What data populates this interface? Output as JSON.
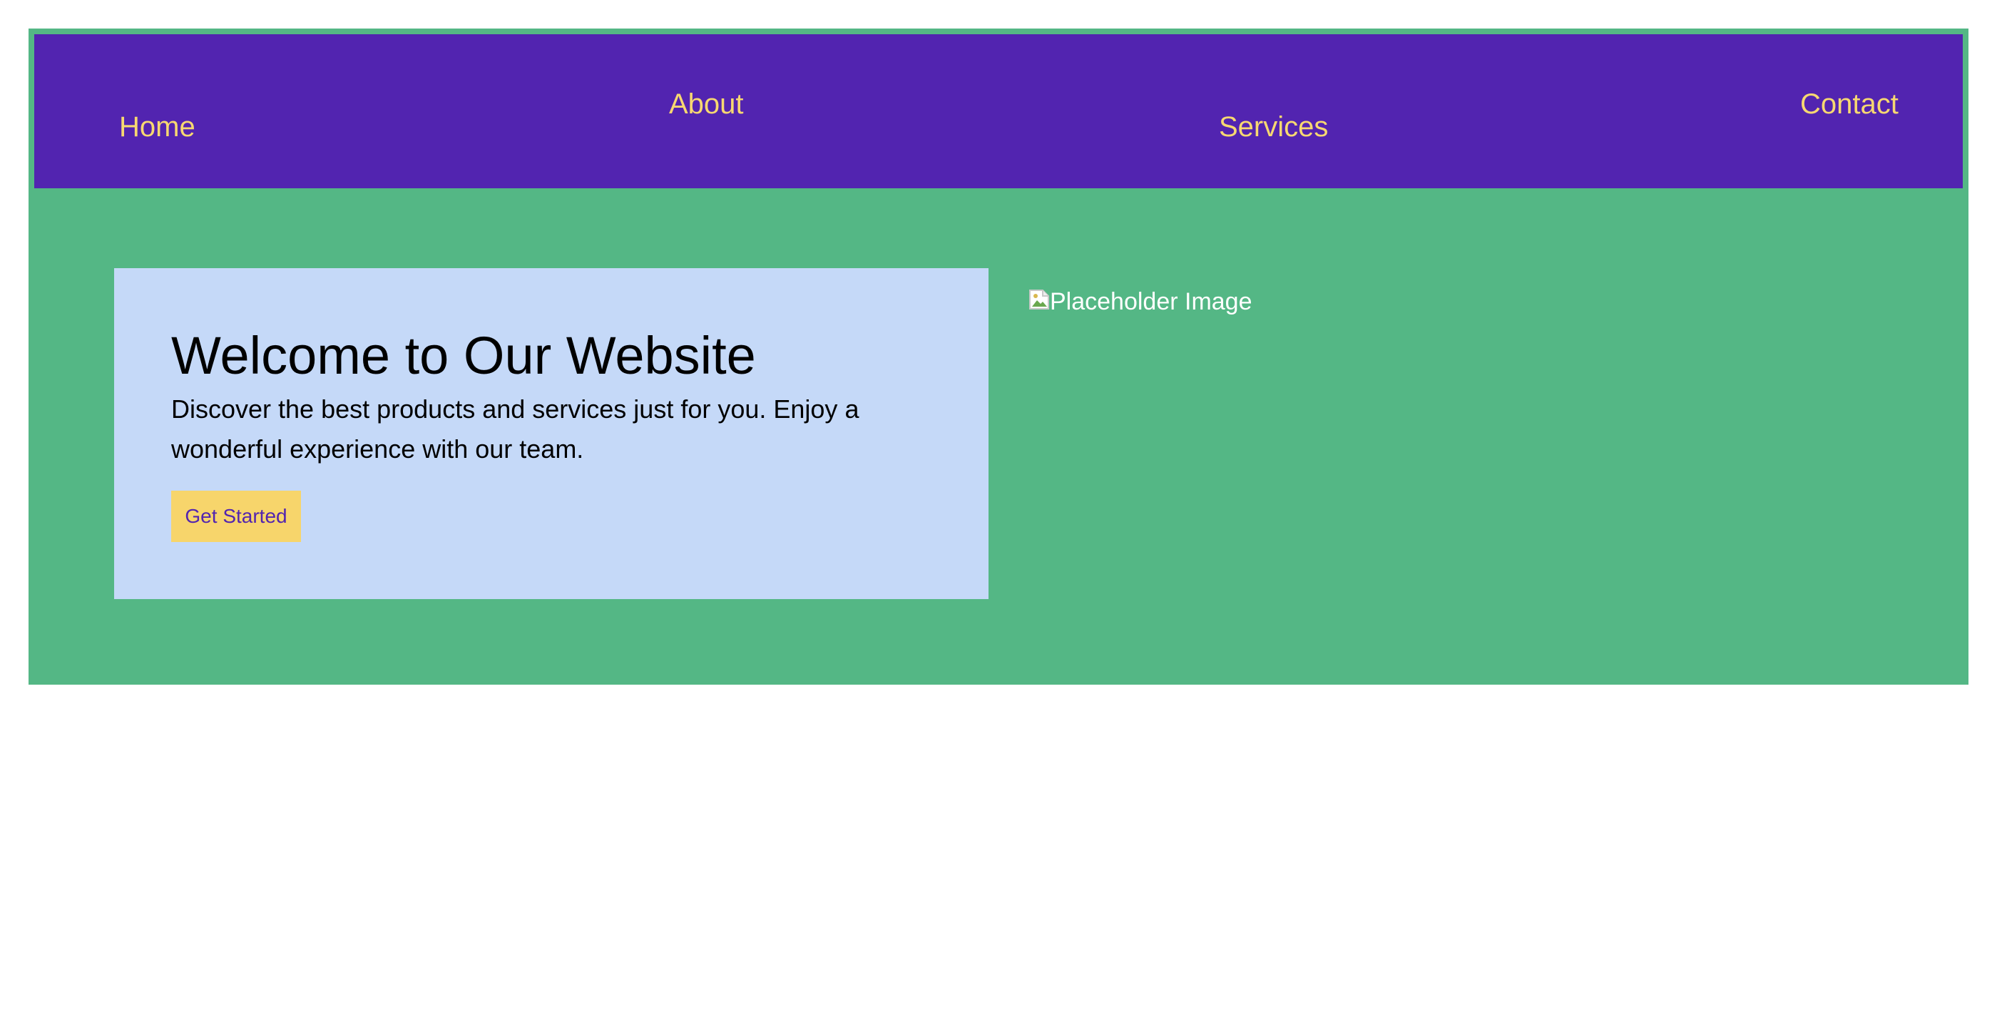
{
  "nav": {
    "items": [
      {
        "label": "Home"
      },
      {
        "label": "About"
      },
      {
        "label": "Services"
      },
      {
        "label": "Contact"
      }
    ]
  },
  "hero": {
    "title": "Welcome to Our Website",
    "text": "Discover the best products and services just for you. Enjoy a wonderful experience with our team.",
    "button_label": "Get Started"
  },
  "image": {
    "alt_text": "Placeholder Image",
    "icon": "broken-image-icon"
  },
  "colors": {
    "page_background": "#ffffff",
    "section_background": "#54b785",
    "nav_background": "#5224b0",
    "nav_text": "#f7d871",
    "card_background": "#c5d9f8",
    "button_background": "#f7d56b",
    "button_text": "#5224b0"
  }
}
